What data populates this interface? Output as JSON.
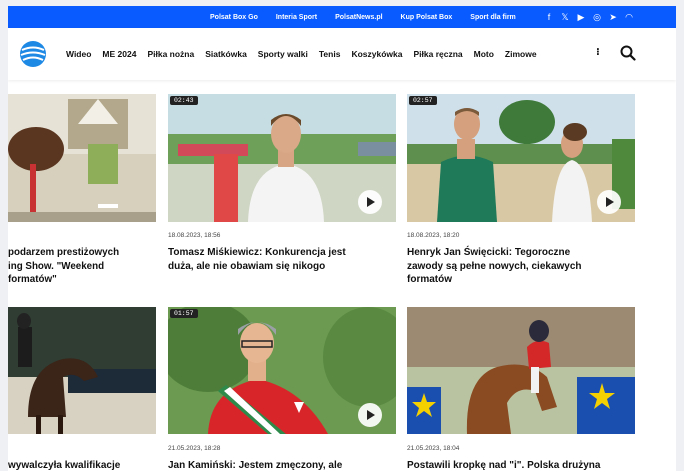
{
  "topbar": {
    "links": [
      "Polsat Box Go",
      "Interia Sport",
      "PolsatNews.pl",
      "Kup Polsat Box",
      "Sport dla firm"
    ],
    "social_icons": [
      "facebook-icon",
      "x-icon",
      "youtube-icon",
      "instagram-icon",
      "telegram-icon",
      "rss-icon"
    ]
  },
  "nav": {
    "menu": [
      "Wideo",
      "ME 2024",
      "Piłka nożna",
      "Siatkówka",
      "Sporty walki",
      "Tenis",
      "Koszykówka",
      "Piłka ręczna",
      "Moto",
      "Zimowe"
    ],
    "more": "⁝"
  },
  "colors": {
    "brand": "#0a5bff"
  },
  "cards": [
    {
      "duration": "",
      "date": "",
      "title": "podarzem prestiżowych\ning Show. \"Weekend\nformatów\""
    },
    {
      "duration": "02:43",
      "date": "18.08.2023, 18:56",
      "title": "Tomasz Miśkiewicz: Konkurencja jest\nduża, ale nie obawiam się nikogo"
    },
    {
      "duration": "02:57",
      "date": "18.08.2023, 18:20",
      "title": "Henryk Jan Święcicki: Tegoroczne\nzawody są pełne nowych, ciekawych\nformatów"
    },
    {
      "duration": "",
      "date": "",
      "title": "wywalczyła kwalifikacje"
    },
    {
      "duration": "01:57",
      "date": "21.05.2023, 18:28",
      "title": "Jan Kamiński: Jestem zmęczony, ale"
    },
    {
      "duration": "",
      "date": "21.05.2023, 18:04",
      "title": "Postawili kropkę nad \"i\". Polska drużyna"
    }
  ]
}
